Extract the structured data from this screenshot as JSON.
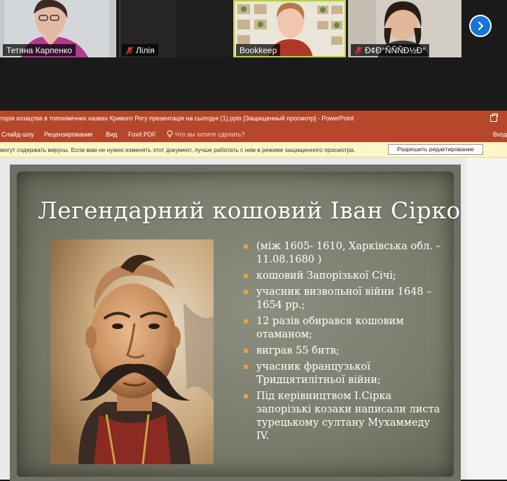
{
  "participants": [
    {
      "name": "Тетяна Карпенко",
      "muted": false
    },
    {
      "name": "Лілія",
      "muted": true
    },
    {
      "name": "Bookkeep",
      "muted": false,
      "active_speaker": true
    },
    {
      "name": "Ð¢Ð°ÑÑÑÐ½Ð°",
      "muted": true
    }
  ],
  "next_icon": "chevron-right-icon",
  "window": {
    "title": "торія козацтва в топонімічних назвах Кривого Рогу презентація на сьогодні (1).pptx [Защищенный просмотр] - PowerPoint"
  },
  "ribbon": {
    "tabs": [
      "Слайд-шоу",
      "Рецензирование",
      "Вид",
      "Foxit PDF"
    ],
    "help_placeholder": "Что вы хотите сделать?",
    "signin": "Вход"
  },
  "protected_view": {
    "message": "могут содержать вирусы. Если вам не нужно изменять этот документ, лучше работать с ним в режиме защищенного просмотра.",
    "button": "Разрешить редактирование"
  },
  "slide": {
    "title": "Легендарний кошовий Іван Сірко",
    "bullets": [
      "(між 1605- 1610, Харківська обл. – 11.08.1680 )",
      "кошовий Запорізької Січі;",
      "учасник визвольної війни 1648 – 1654 рр.;",
      "12 разів обирався кошовим отаманом;",
      "виграв 55 битв;",
      "учасник французької Тридцятилітньої війни;",
      "Під  керівництвом І.Сірка запорізькі козаки написали листа турецькому султану Мухаммеду IV."
    ]
  },
  "colors": {
    "powerpoint_red": "#b7472a",
    "active_speaker_border": "#b7d335",
    "bullet_orange": "#e8a23a",
    "next_button_blue": "#1476d6"
  }
}
